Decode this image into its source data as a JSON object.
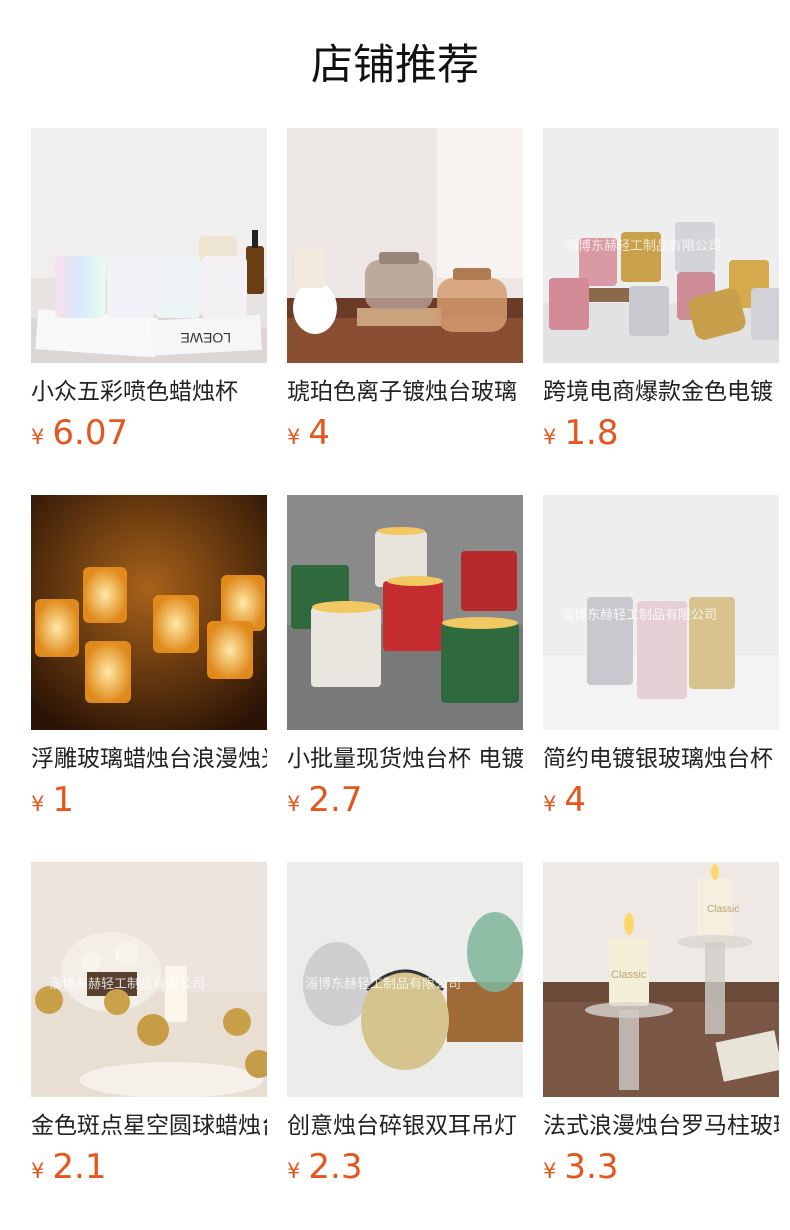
{
  "page": {
    "title": "店铺推荐",
    "currency_symbol": "¥"
  },
  "products": [
    {
      "name": "小众五彩喷色蜡烛杯",
      "price": "6.07",
      "image_icon": "iridescent-candle-cups-photo"
    },
    {
      "name": "琥珀色离子镀烛台玻璃",
      "price": "4",
      "image_icon": "amber-glass-jars-photo"
    },
    {
      "name": "跨境电商爆款金色电镀",
      "price": "1.8",
      "image_icon": "mercury-glass-votives-photo"
    },
    {
      "name": "浮雕玻璃蜡烛台浪漫烛光",
      "price": "1",
      "image_icon": "embossed-glowing-votives-photo"
    },
    {
      "name": "小批量现货烛台杯 电镀",
      "price": "2.7",
      "image_icon": "christmas-candle-cups-photo"
    },
    {
      "name": "简约电镀银玻璃烛台杯",
      "price": "4",
      "image_icon": "silver-plated-glass-cups-photo"
    },
    {
      "name": "金色斑点星空圆球蜡烛台",
      "price": "2.1",
      "image_icon": "gold-speckled-globe-holders-photo"
    },
    {
      "name": "创意烛台碎银双耳吊灯",
      "price": "2.3",
      "image_icon": "mercury-glass-lanterns-photo"
    },
    {
      "name": "法式浪漫烛台罗马柱玻璃",
      "price": "3.3",
      "image_icon": "roman-pillar-glass-stands-photo"
    }
  ],
  "watermark": "淄博东赫轻工制品有限公司",
  "image_labels": {
    "loewe": "LOEWE",
    "classic": "Classic"
  }
}
